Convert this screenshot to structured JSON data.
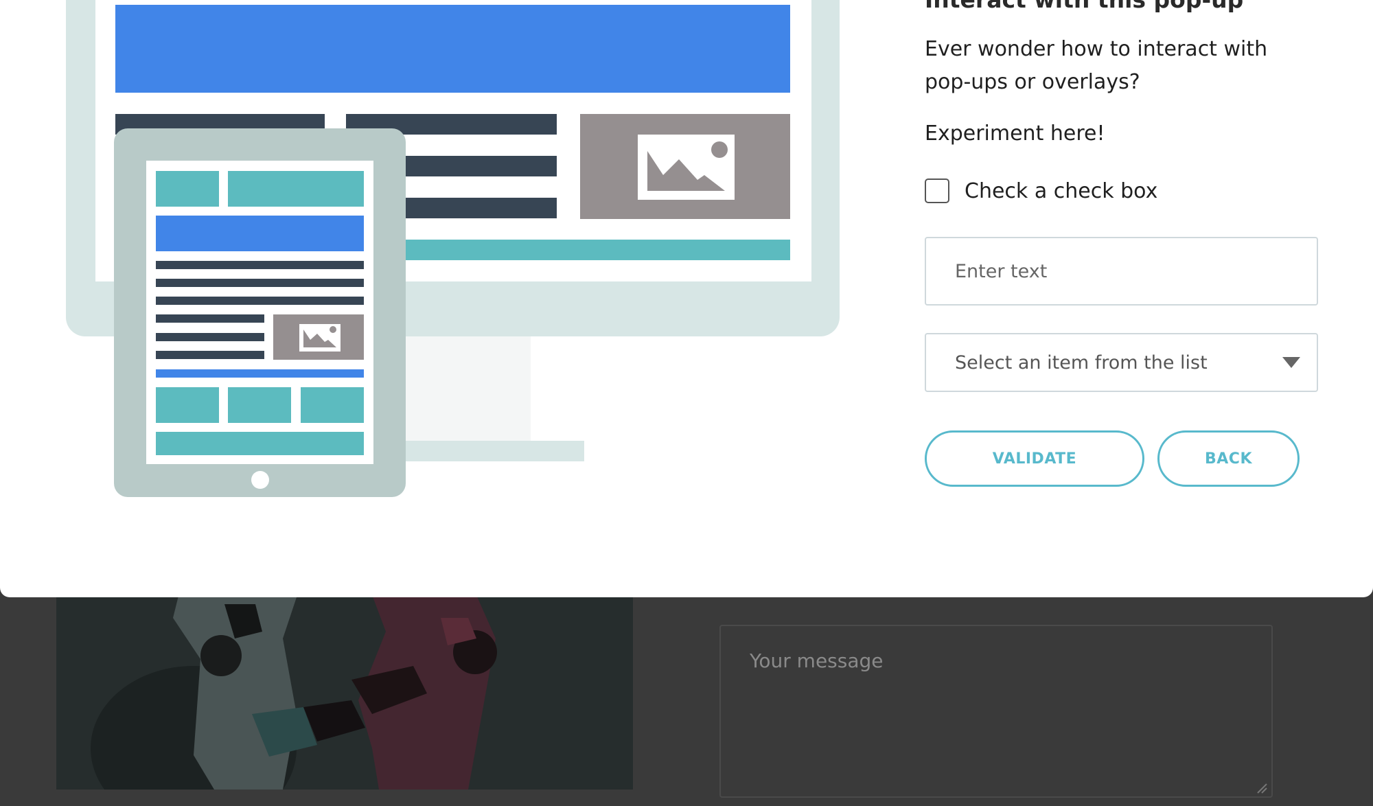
{
  "modal": {
    "title": "Interact with this pop-up",
    "description": "Ever wonder how to interact with pop-ups or overlays?",
    "subtitle": "Experiment here!",
    "checkbox": {
      "label": "Check a check box",
      "checked": false
    },
    "text_input": {
      "placeholder": "Enter text",
      "value": ""
    },
    "select": {
      "selected": "Select an item from the list"
    },
    "buttons": {
      "validate": "VALIDATE",
      "back": "BACK"
    }
  },
  "background": {
    "message_placeholder": "Your message"
  },
  "colors": {
    "accent": "#58b9cc",
    "overlay": "#3a3a3a",
    "illustration_blue": "#4185e8",
    "illustration_teal": "#5cbbbf",
    "illustration_navy": "#374554",
    "illustration_gray": "#958f90"
  }
}
